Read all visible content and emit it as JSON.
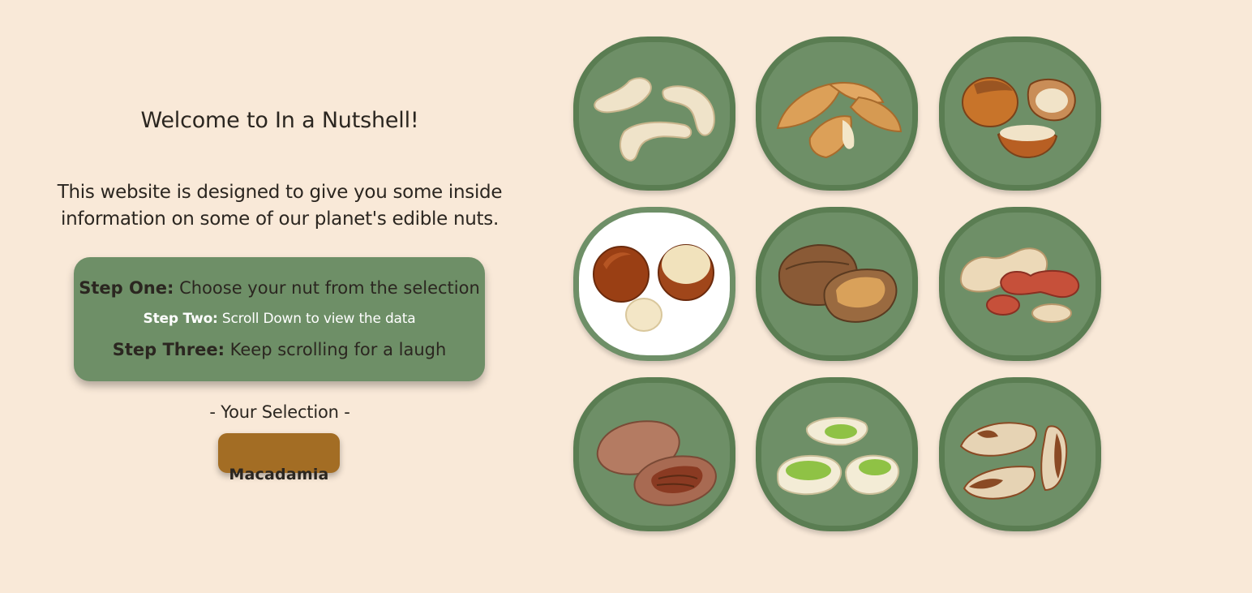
{
  "welcome": {
    "title": "Welcome to In a Nutshell!",
    "intro_line1": "This website is designed to give you some inside",
    "intro_line2": "information on some of our planet's edible nuts."
  },
  "steps": [
    {
      "label": "Step One:",
      "text": " Choose your nut from the selection"
    },
    {
      "label": "Step Two:",
      "text": " Scroll Down to view the data"
    },
    {
      "label": "Step Three:",
      "text": " Keep scrolling for a laugh"
    }
  ],
  "selection": {
    "label": "- Your Selection -",
    "value": "Macadamia"
  },
  "nuts": [
    {
      "icon": "cashew-icon",
      "selected": false
    },
    {
      "icon": "almond-icon",
      "selected": false
    },
    {
      "icon": "hazelnut-icon",
      "selected": false
    },
    {
      "icon": "macadamia-icon",
      "selected": true
    },
    {
      "icon": "walnut-icon",
      "selected": false
    },
    {
      "icon": "peanut-icon",
      "selected": false
    },
    {
      "icon": "pecan-icon",
      "selected": false
    },
    {
      "icon": "pistachio-icon",
      "selected": false
    },
    {
      "icon": "brazil-nut-icon",
      "selected": false
    }
  ],
  "colors": {
    "background": "#f9e9d8",
    "tile": "#6e8f67",
    "tile_border": "#5a7d52",
    "selection_button": "#a36d24"
  }
}
